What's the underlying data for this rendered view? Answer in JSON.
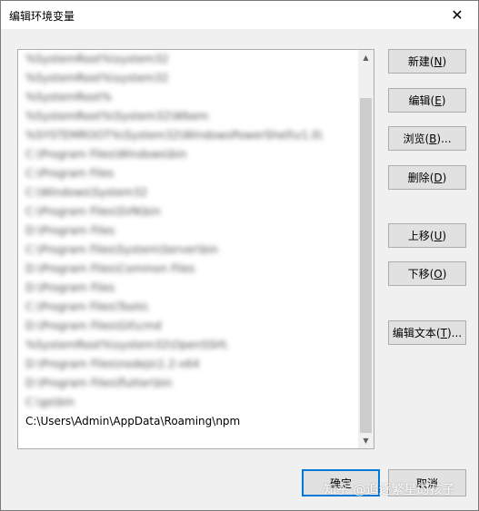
{
  "window": {
    "title": "编辑环境变量",
    "close_glyph": "✕"
  },
  "list": {
    "items": [
      {
        "text": "%SystemRoot%\\system32",
        "blurred": true
      },
      {
        "text": "%SystemRoot%\\system32",
        "blurred": true
      },
      {
        "text": "%SystemRoot%",
        "blurred": true
      },
      {
        "text": "%SystemRoot%\\System32\\Wbem",
        "blurred": true
      },
      {
        "text": "%SYSTEMROOT%\\System32\\WindowsPowerShell\\v1.0\\",
        "blurred": true
      },
      {
        "text": "C:\\Program Files\\Windows\\bin",
        "blurred": true
      },
      {
        "text": "C:\\Program Files",
        "blurred": true
      },
      {
        "text": "C:\\Windows\\System32",
        "blurred": true
      },
      {
        "text": "C:\\Program Files\\SVN\\bin",
        "blurred": true
      },
      {
        "text": "D:\\Program Files",
        "blurred": true
      },
      {
        "text": "C:\\Program Files\\System\\Server\\bin",
        "blurred": true
      },
      {
        "text": "D:\\Program Files\\Common Files",
        "blurred": true
      },
      {
        "text": "D:\\Program Files",
        "blurred": true
      },
      {
        "text": "C:\\Program Files\\Tools\\",
        "blurred": true
      },
      {
        "text": "D:\\Program Files\\Git\\cmd",
        "blurred": true
      },
      {
        "text": "%SystemRoot%\\system32\\OpenSSH\\",
        "blurred": true
      },
      {
        "text": "D:\\Program Files\\nodejs\\1.2-x64",
        "blurred": true
      },
      {
        "text": "D:\\Program Files\\flutter\\bin",
        "blurred": true
      },
      {
        "text": "C:\\go\\bin",
        "blurred": true
      },
      {
        "text": "C:\\Users\\Admin\\AppData\\Roaming\\npm",
        "blurred": false
      }
    ]
  },
  "scrollbar": {
    "up_glyph": "▲",
    "down_glyph": "▼"
  },
  "buttons": {
    "new": {
      "label": "新建",
      "key": "N"
    },
    "edit": {
      "label": "编辑",
      "key": "E"
    },
    "browse": {
      "label": "浏览",
      "key": "B",
      "suffix": "..."
    },
    "delete": {
      "label": "删除",
      "key": "D"
    },
    "move_up": {
      "label": "上移",
      "key": "U"
    },
    "move_down": {
      "label": "下移",
      "key": "O"
    },
    "edit_text": {
      "label": "编辑文本",
      "key": "T",
      "suffix": "..."
    },
    "ok": "确定",
    "cancel": "取消"
  },
  "watermark": "知乎 @追逐繁星的孩子",
  "colors": {
    "focus_border": "#0078d7",
    "button_bg": "#e1e1e1",
    "window_bg": "#f0f0f0"
  }
}
